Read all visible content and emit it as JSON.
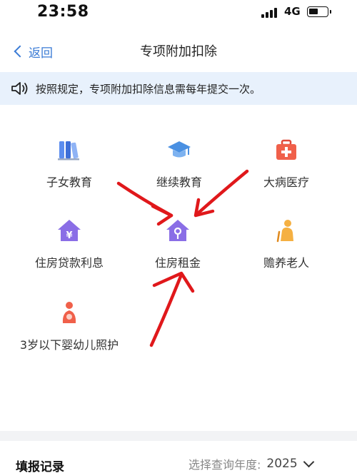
{
  "status_bar": {
    "time": "23:58",
    "network": "4G"
  },
  "nav": {
    "back_label": "返回",
    "title": "专项附加扣除"
  },
  "notice": {
    "text": "按照规定，专项附加扣除信息需每年提交一次。"
  },
  "items": [
    {
      "label": "子女教育",
      "icon": "books-icon"
    },
    {
      "label": "继续教育",
      "icon": "graduation-cap-icon"
    },
    {
      "label": "大病医疗",
      "icon": "medical-kit-icon"
    },
    {
      "label": "住房贷款利息",
      "icon": "house-yuan-icon"
    },
    {
      "label": "住房租金",
      "icon": "house-key-icon"
    },
    {
      "label": "赡养老人",
      "icon": "elderly-person-icon"
    },
    {
      "label": "3岁以下婴幼儿照护",
      "icon": "mother-baby-icon"
    }
  ],
  "records": {
    "title": "填报记录",
    "year_label": "选择查询年度:",
    "year_value": "2025"
  },
  "colors": {
    "accent_blue": "#3a7bd5",
    "notice_bg": "#e8f1fc",
    "annotation_red": "#e0181b",
    "icon_purple": "#8a6ee6",
    "icon_red": "#f0604a"
  }
}
